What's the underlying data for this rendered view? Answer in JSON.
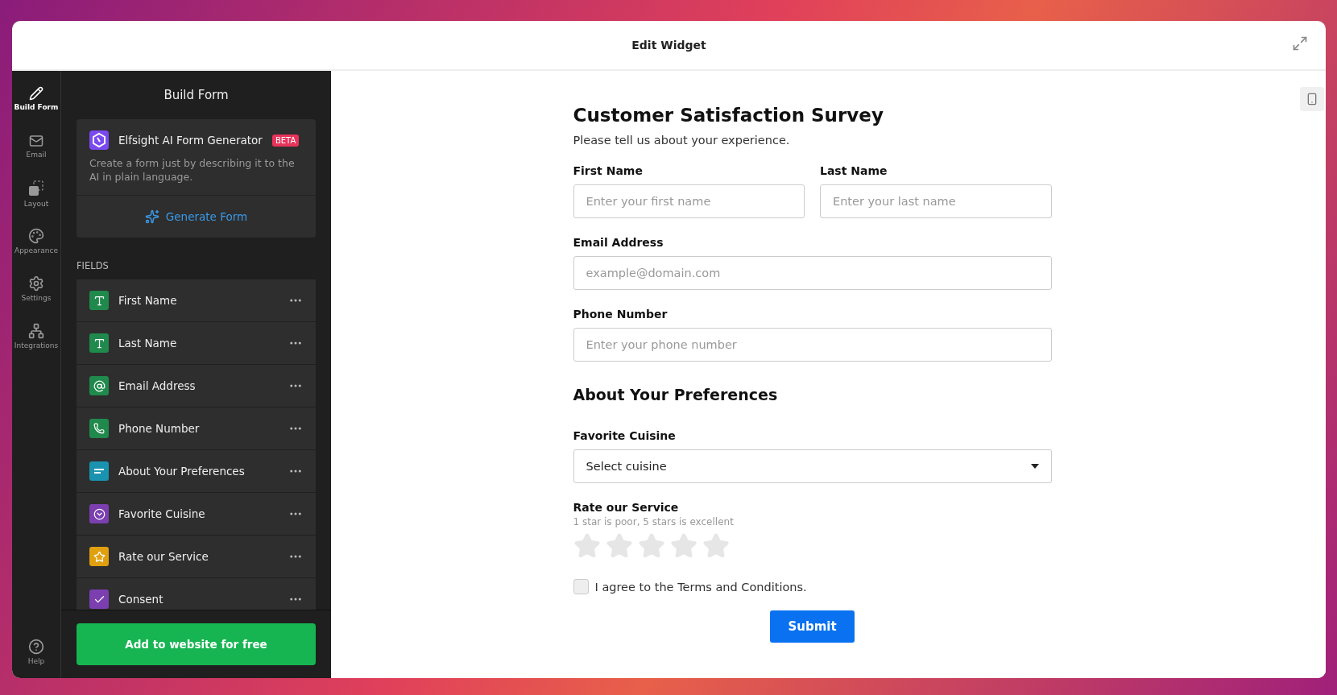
{
  "window": {
    "title": "Edit Widget"
  },
  "nav": [
    {
      "kind": "build",
      "label": "Build Form",
      "selected": true
    },
    {
      "kind": "email",
      "label": "Email",
      "selected": false
    },
    {
      "kind": "layout",
      "label": "Layout",
      "selected": false
    },
    {
      "kind": "appearance",
      "label": "Appearance",
      "selected": false
    },
    {
      "kind": "settings",
      "label": "Settings",
      "selected": false
    },
    {
      "kind": "integrations",
      "label": "Integrations",
      "selected": false
    }
  ],
  "help": {
    "label": "Help"
  },
  "sidebar": {
    "title": "Build Form",
    "ai_card": {
      "title": "Elfsight AI Form Generator",
      "badge": "BETA",
      "description": "Create a form just by describing it to the AI in plain language.",
      "action": "Generate Form"
    },
    "fields_heading": "FIELDS",
    "fields": [
      {
        "kind": "text",
        "label": "First Name",
        "color": "#1f8a4c"
      },
      {
        "kind": "text",
        "label": "Last Name",
        "color": "#1f8a4c"
      },
      {
        "kind": "email",
        "label": "Email Address",
        "color": "#1f8a4c"
      },
      {
        "kind": "phone",
        "label": "Phone Number",
        "color": "#1f8a4c"
      },
      {
        "kind": "heading",
        "label": "About Your Preferences",
        "color": "#1a93b0"
      },
      {
        "kind": "select",
        "label": "Favorite Cuisine",
        "color": "#7b3fb0"
      },
      {
        "kind": "rating",
        "label": "Rate our Service",
        "color": "#e0a010"
      },
      {
        "kind": "checkbox",
        "label": "Consent",
        "color": "#7b3fb0"
      }
    ],
    "add_button": "Add to website for free"
  },
  "form": {
    "title": "Customer Satisfaction Survey",
    "subtitle": "Please tell us about your experience.",
    "rows": [
      {
        "kind": "pair",
        "fields": [
          {
            "label": "First Name",
            "placeholder": "Enter your first name"
          },
          {
            "label": "Last Name",
            "placeholder": "Enter your last name"
          }
        ]
      },
      {
        "kind": "input",
        "label": "Email Address",
        "placeholder": "example@domain.com"
      },
      {
        "kind": "input",
        "label": "Phone Number",
        "placeholder": "Enter your phone number"
      },
      {
        "kind": "heading",
        "text": "About Your Preferences"
      },
      {
        "kind": "select",
        "label": "Favorite Cuisine",
        "value": "Select cuisine"
      },
      {
        "kind": "rating",
        "label": "Rate our Service",
        "hint": "1 star is poor, 5 stars is excellent",
        "stars": 0
      },
      {
        "kind": "checkbox",
        "label": "I agree to the Terms and Conditions.",
        "checked": false
      }
    ],
    "submit": "Submit"
  }
}
